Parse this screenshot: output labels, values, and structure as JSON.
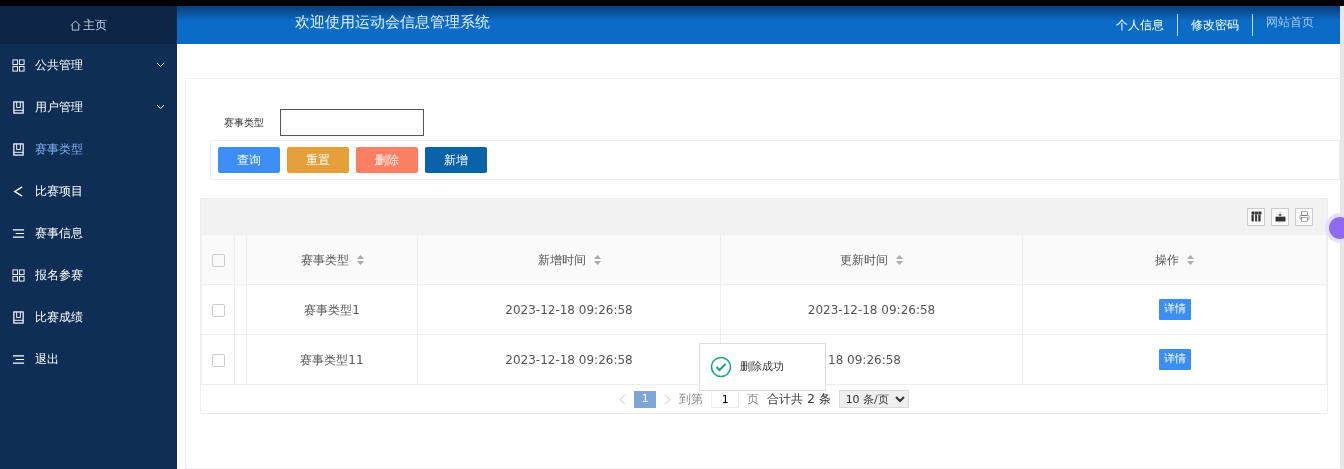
{
  "sidebar": {
    "home": "主页",
    "items": [
      {
        "label": "公共管理",
        "kind": "grid",
        "submenu": true,
        "selected": false
      },
      {
        "label": "用户管理",
        "kind": "book",
        "submenu": true,
        "selected": false
      },
      {
        "label": "赛事类型",
        "kind": "book",
        "submenu": false,
        "selected": true
      },
      {
        "label": "比赛项目",
        "kind": "share",
        "submenu": false,
        "selected": false
      },
      {
        "label": "赛事信息",
        "kind": "list",
        "submenu": false,
        "selected": false
      },
      {
        "label": "报名参赛",
        "kind": "grid",
        "submenu": false,
        "selected": false
      },
      {
        "label": "比赛成绩",
        "kind": "book",
        "submenu": false,
        "selected": false
      },
      {
        "label": "退出",
        "kind": "list",
        "submenu": false,
        "selected": false
      }
    ]
  },
  "header": {
    "title": "欢迎使用运动会信息管理系统",
    "links": [
      {
        "label": "个人信息",
        "muted": false
      },
      {
        "label": "修改密码",
        "muted": false
      },
      {
        "label": "网站首页",
        "muted": true
      }
    ]
  },
  "search": {
    "label": "赛事类型",
    "buttons": [
      {
        "label": "查询",
        "color": "#3c8ef5"
      },
      {
        "label": "重置",
        "color": "#e5a03b"
      },
      {
        "label": "删除",
        "color": "#fb7f62"
      },
      {
        "label": "新增",
        "color": "#0a63a8"
      }
    ]
  },
  "table": {
    "all_checked": false,
    "columns": [
      "赛事类型",
      "新增时间",
      "更新时间",
      "操作"
    ],
    "rows": [
      {
        "checked": false,
        "cells": [
          "赛事类型1",
          "2023-12-18 09:26:58",
          "2023-12-18 09:26:58"
        ],
        "action": "详情"
      },
      {
        "checked": false,
        "cells": [
          "赛事类型11",
          "2023-12-18 09:26:58",
          "18 09:26:58"
        ],
        "action": "详情"
      }
    ]
  },
  "pagination": {
    "pages": [
      {
        "label": "1",
        "selected": true
      }
    ],
    "goto": "到第",
    "page_value": "1",
    "page_unit": "页",
    "total": "合计共 2 条",
    "page_size": "10 条/页"
  },
  "toast": {
    "message": "删除成功"
  }
}
